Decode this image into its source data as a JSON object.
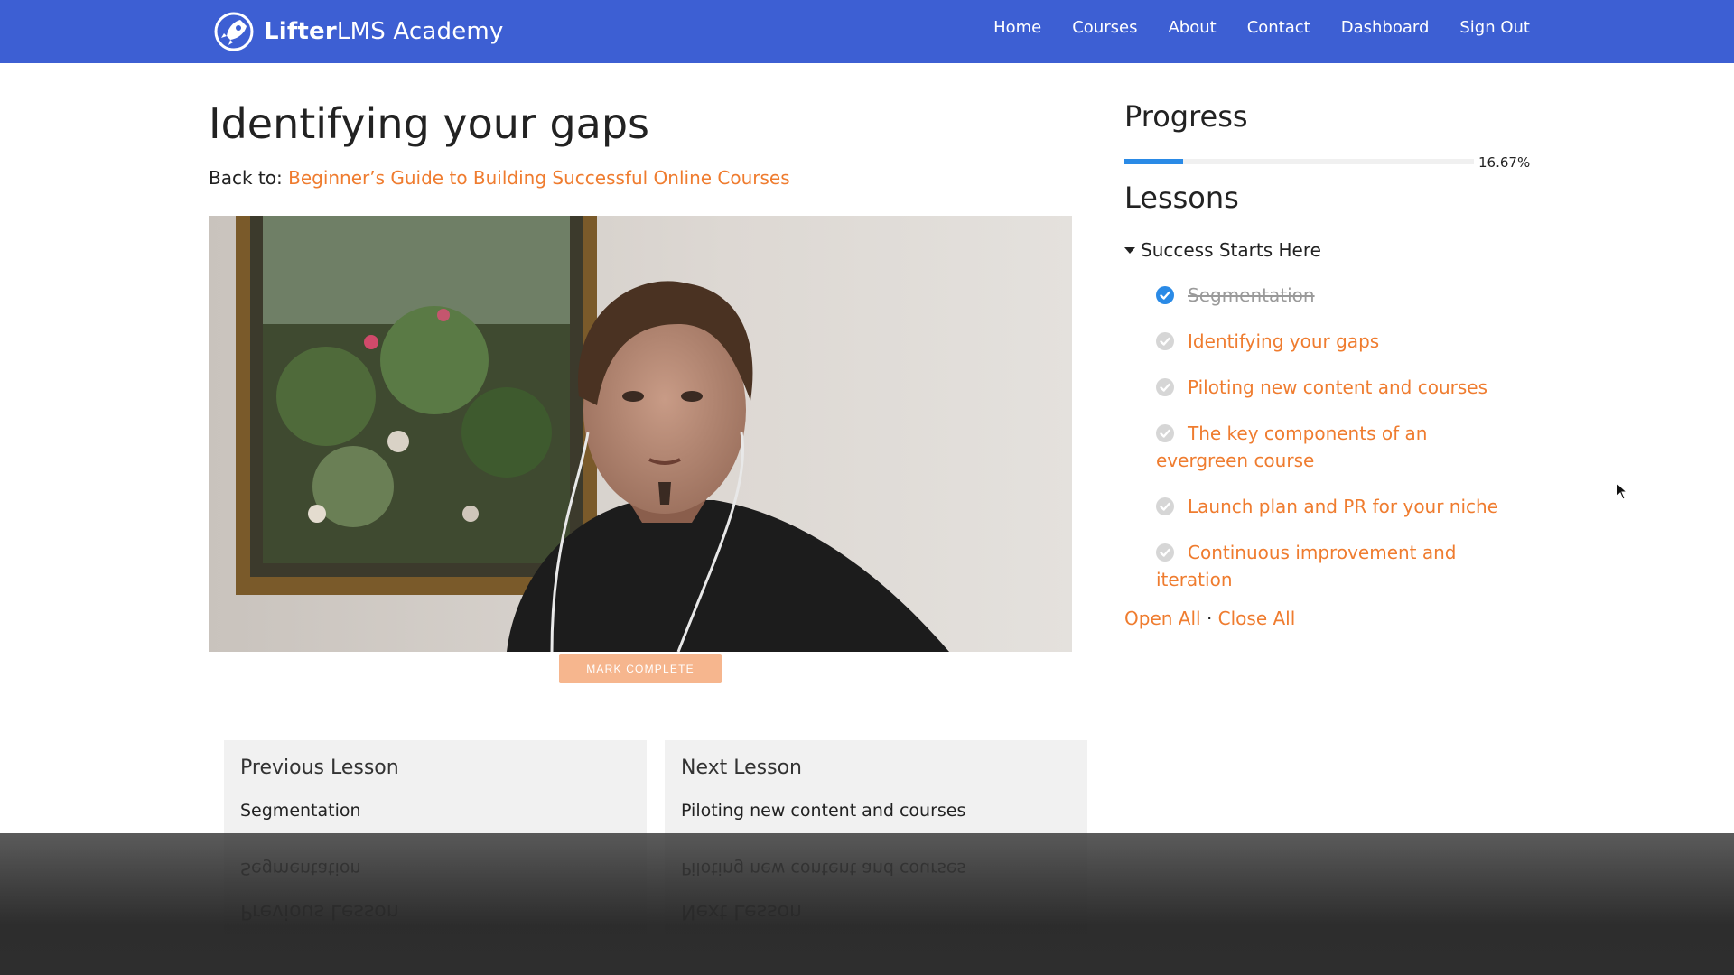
{
  "brand": {
    "name_bold": "Lifter",
    "name_rest": "LMS Academy"
  },
  "nav": [
    {
      "label": "Home"
    },
    {
      "label": "Courses"
    },
    {
      "label": "About"
    },
    {
      "label": "Contact"
    },
    {
      "label": "Dashboard"
    },
    {
      "label": "Sign Out"
    }
  ],
  "lesson": {
    "title": "Identifying your gaps",
    "back_prefix": "Back to:",
    "back_link": "Beginner’s Guide to Building Successful Online Courses",
    "mark_complete_label": "MARK COMPLETE"
  },
  "lesson_nav": {
    "previous": {
      "header": "Previous Lesson",
      "title": "Segmentation"
    },
    "next": {
      "header": "Next Lesson",
      "title": "Piloting new content and courses"
    }
  },
  "sidebar": {
    "progress_heading": "Progress",
    "progress_value": 0.1667,
    "progress_label": "16.67%",
    "lessons_heading": "Lessons",
    "section_title": "Success Starts Here",
    "lessons": [
      {
        "title": "Segmentation",
        "complete": true
      },
      {
        "title": "Identifying your gaps",
        "complete": false
      },
      {
        "title": "Piloting new content and courses",
        "complete": false
      },
      {
        "title": "The key components of an evergreen course",
        "complete": false
      },
      {
        "title": "Launch plan and PR for your niche",
        "complete": false
      },
      {
        "title": "Continuous improvement and iteration",
        "complete": false
      }
    ],
    "open_all": "Open All",
    "separator": "·",
    "close_all": "Close All"
  },
  "colors": {
    "header_bg": "#3d5fd3",
    "accent_orange": "#ef7c2f",
    "progress_blue": "#2a8ae6",
    "check_complete": "#2a8ae6",
    "check_incomplete": "#d6d6d6"
  }
}
